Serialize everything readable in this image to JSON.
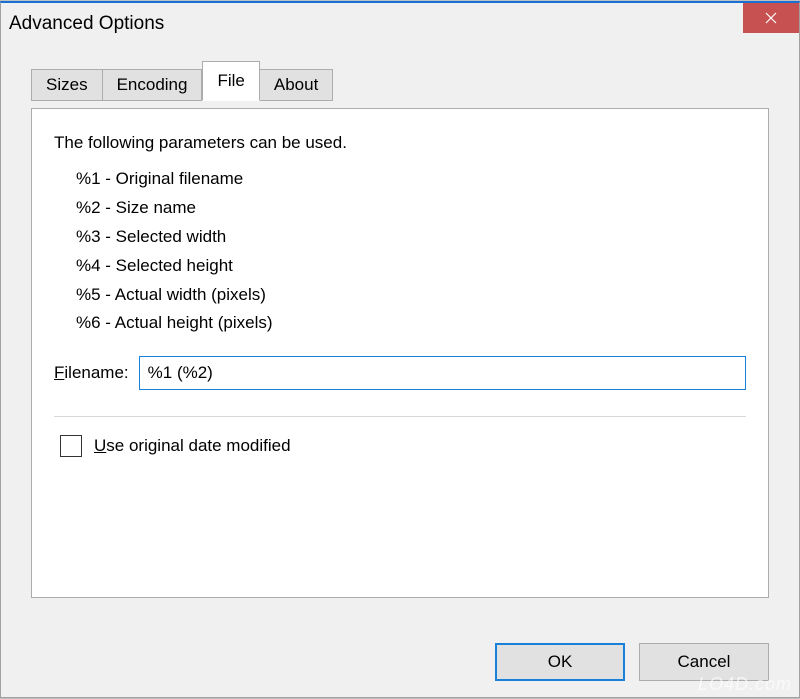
{
  "title": "Advanced Options",
  "tabs": {
    "0": {
      "label": "Sizes"
    },
    "1": {
      "label": "Encoding"
    },
    "2": {
      "label": "File"
    },
    "3": {
      "label": "About"
    }
  },
  "panel": {
    "intro": "The following parameters can be used.",
    "params": {
      "0": "%1 - Original filename",
      "1": "%2 - Size name",
      "2": "%3 - Selected width",
      "3": "%4 - Selected height",
      "4": "%5 - Actual width (pixels)",
      "5": "%6 - Actual height (pixels)"
    },
    "filename_label_pre": "F",
    "filename_label_rest": "ilename:",
    "filename_value": "%1 (%2)",
    "checkbox_checked": false,
    "checkbox_label_pre": "U",
    "checkbox_label_rest": "se original date modified"
  },
  "buttons": {
    "ok": "OK",
    "cancel": "Cancel"
  },
  "watermark": "LO4D.com"
}
